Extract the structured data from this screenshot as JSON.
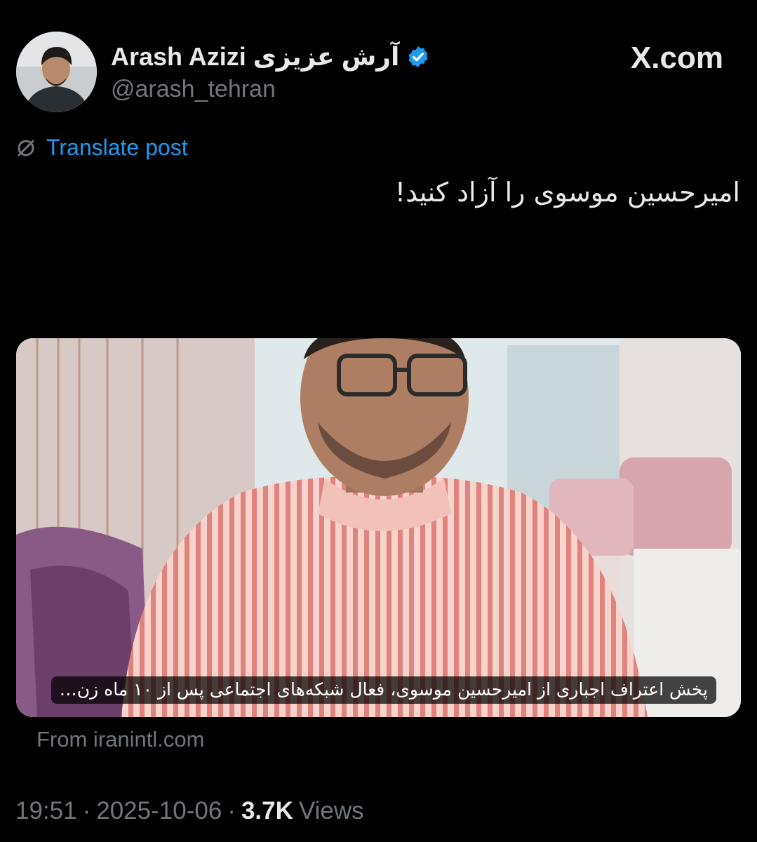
{
  "author": {
    "display_name": "Arash Azizi",
    "display_name_fa": "آرش عزیزی",
    "handle": "@arash_tehran",
    "verified": true
  },
  "source_label": "X.com",
  "translate_label": "Translate post",
  "post": {
    "text": "امیرحسین موسوی را آزاد کنید!"
  },
  "link_card": {
    "title": "پخش اعتراف اجباری از امیرحسین موسوی، فعال شبکه‌های اجتماعی پس از ۱۰ ماه زن…",
    "from": "From iranintl.com"
  },
  "meta": {
    "time": "19:51",
    "date": "2025-10-06",
    "views_count": "3.7K",
    "views_label": "Views",
    "separator": "·"
  },
  "colors": {
    "background": "#000000",
    "primary_text": "#e7e9ea",
    "secondary_text": "#71767b",
    "link_blue": "#1d9bf0",
    "verified_blue": "#1d9bf0"
  },
  "icons": [
    "verified-badge-icon",
    "x-logo-icon",
    "translate-icon"
  ]
}
